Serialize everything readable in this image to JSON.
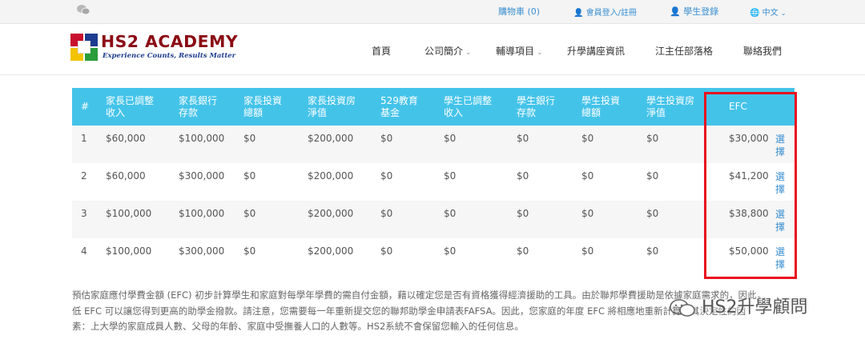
{
  "topbar": {
    "cart": "購物車 (0)",
    "login": "會員登入/註冊",
    "student_login": "學生登錄",
    "language": "中文"
  },
  "brand": {
    "name": "HS2 ACADEMY",
    "slogan": "Experience Counts, Results Matter",
    "colors": {
      "primary": "#8b0a14",
      "slogan": "#1d3c8f"
    }
  },
  "nav": {
    "items": [
      {
        "label": "首頁"
      },
      {
        "label": "公司簡介"
      },
      {
        "label": "輔導項目"
      },
      {
        "label": "升學講座資訊"
      },
      {
        "label": "江主任部落格"
      },
      {
        "label": "聯絡我們"
      }
    ]
  },
  "table": {
    "headers": [
      "#",
      "家長已調整收入",
      "家長銀行存款",
      "家長投資總額",
      "家長投資房淨值",
      "529教育基金",
      "學生已調整收入",
      "學生銀行存款",
      "學生投資總額",
      "學生投資房淨值",
      "EFC",
      ""
    ],
    "rows": [
      {
        "n": "1",
        "c1": "$60,000",
        "c2": "$100,000",
        "c3": "$0",
        "c4": "$200,000",
        "c5": "$0",
        "c6": "$0",
        "c7": "$0",
        "c8": "$0",
        "c9": "$0",
        "efc": "$30,000",
        "action": "選擇"
      },
      {
        "n": "2",
        "c1": "$60,000",
        "c2": "$300,000",
        "c3": "$0",
        "c4": "$200,000",
        "c5": "$0",
        "c6": "$0",
        "c7": "$0",
        "c8": "$0",
        "c9": "$0",
        "efc": "$41,200",
        "action": "選擇"
      },
      {
        "n": "3",
        "c1": "$100,000",
        "c2": "$100,000",
        "c3": "$0",
        "c4": "$200,000",
        "c5": "$0",
        "c6": "$0",
        "c7": "$0",
        "c8": "$0",
        "c9": "$0",
        "efc": "$38,800",
        "action": "選擇"
      },
      {
        "n": "4",
        "c1": "$100,000",
        "c2": "$300,000",
        "c3": "$0",
        "c4": "$200,000",
        "c5": "$0",
        "c6": "$0",
        "c7": "$0",
        "c8": "$0",
        "c9": "$0",
        "efc": "$50,000",
        "action": "選擇"
      }
    ]
  },
  "description": {
    "line1": "預估家庭應付學費金額 (EFC) 初步計算學生和家庭對每學年學費的需自付金額，藉以確定您是否有資格獲得經濟援助的工具。由於聯邦學費援助是依據家庭需求的，因此，",
    "line2": "低 EFC 可以讓您得到更高的助學金撥款。請注意，您需要每一年重新提交您的聯邦助學金申請表FAFSA。因此，您家庭的年度 EFC 將相應地重新計算，其決定性的因",
    "line3": "素：上大學的家庭成員人數、父母的年齡、家庭中受撫養人口的人數等。HS2系統不會保留您輸入的任何信息。"
  },
  "watermark": "HS2升學顧問",
  "colors": {
    "header_blue": "#44c3e9",
    "link_blue": "#3a8fd1",
    "highlight_red": "#e8101f"
  }
}
